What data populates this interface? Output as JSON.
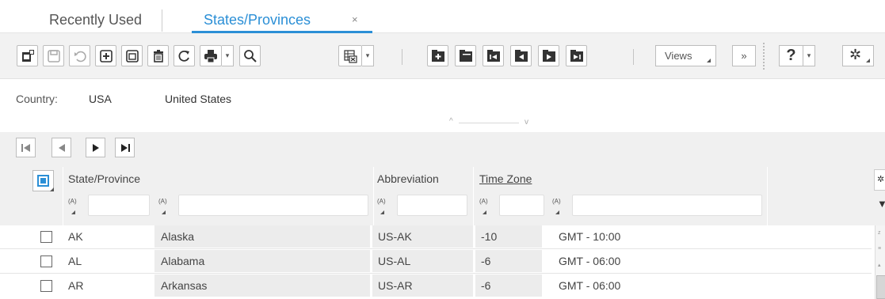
{
  "tabs": {
    "recent_label": "Recently Used",
    "active_label": "States/Provinces",
    "close_glyph": "×"
  },
  "toolbar": {
    "views_label": "Views",
    "more_label": "»",
    "help_label": "?",
    "settings_glyph": "✲",
    "dropdown_glyph": "▾",
    "icons": [
      "new-record-icon",
      "save-icon",
      "undo-icon",
      "add-row-icon",
      "copy-icon",
      "delete-icon",
      "refresh-icon",
      "print-icon",
      "search-icon",
      "export-icon",
      "first-group-icon",
      "folder-icon",
      "first-record-icon",
      "previous-record-icon",
      "next-record-icon",
      "last-record-icon"
    ]
  },
  "header": {
    "country_label": "Country:",
    "country_code": "USA",
    "country_name": "United States"
  },
  "grid": {
    "columns": {
      "state": "State/Province",
      "abbreviation": "Abbreviation",
      "time_zone": "Time Zone"
    },
    "filter_hint": "(A)",
    "rows": [
      {
        "code": "AK",
        "name": "Alaska",
        "abbr": "US-AK",
        "offset": "-10",
        "gmt": "GMT - 10:00"
      },
      {
        "code": "AL",
        "name": "Alabama",
        "abbr": "US-AL",
        "offset": "-6",
        "gmt": "GMT - 06:00"
      },
      {
        "code": "AR",
        "name": "Arkansas",
        "abbr": "US-AR",
        "offset": "-6",
        "gmt": "GMT - 06:00"
      }
    ]
  },
  "colors": {
    "accent": "#2b8fd6",
    "toolbar_bg": "#f2f2f2",
    "grid_bg": "#f0f0f0"
  }
}
